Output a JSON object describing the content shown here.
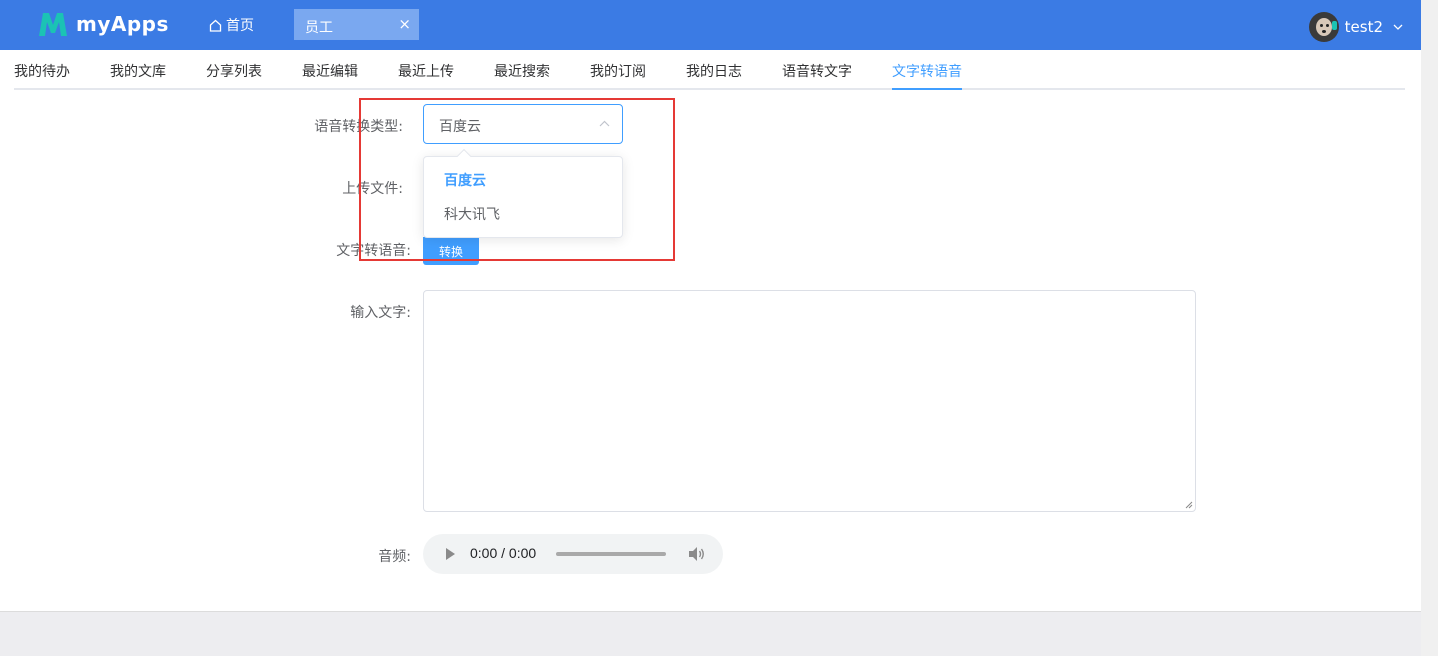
{
  "header": {
    "app_name": "myApps",
    "home_label": "首页",
    "open_tab_label": "员工",
    "close_symbol": "×",
    "username": "test2",
    "brand_color": "#3b7be4",
    "accent_color": "#1bc3b4"
  },
  "tabs": [
    {
      "label": "我的待办",
      "active": false
    },
    {
      "label": "我的文库",
      "active": false
    },
    {
      "label": "分享列表",
      "active": false
    },
    {
      "label": "最近编辑",
      "active": false
    },
    {
      "label": "最近上传",
      "active": false
    },
    {
      "label": "最近搜索",
      "active": false
    },
    {
      "label": "我的订阅",
      "active": false
    },
    {
      "label": "我的日志",
      "active": false
    },
    {
      "label": "语音转文字",
      "active": false
    },
    {
      "label": "文字转语音",
      "active": true
    }
  ],
  "form": {
    "type_label": "语音转换类型:",
    "type_value": "百度云",
    "type_options": [
      "百度云",
      "科大讯飞"
    ],
    "upload_label": "上传文件:",
    "convert_label": "文字转语音:",
    "convert_button": "转换",
    "input_label": "输入文字:",
    "input_value": "",
    "audio_label": "音频:",
    "audio_time": "0:00 / 0:00"
  },
  "colors": {
    "active_tab": "#409eff",
    "highlight_box": "#e53935"
  }
}
